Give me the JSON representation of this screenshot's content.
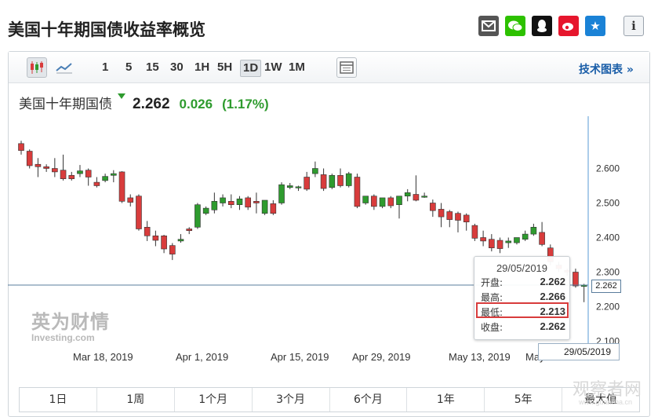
{
  "page": {
    "title": "美国十年期国债收益率概览"
  },
  "share": [
    {
      "name": "mail-icon",
      "glyph": "✉",
      "color": "#555555"
    },
    {
      "name": "wechat-icon",
      "glyph": "●",
      "color": "#2dc100"
    },
    {
      "name": "qq-icon",
      "glyph": "♟",
      "color": "#111111"
    },
    {
      "name": "weibo-icon",
      "glyph": "◉",
      "color": "#e6162d"
    },
    {
      "name": "favorite-star-icon",
      "glyph": "★",
      "color": "#1a82d6"
    }
  ],
  "info_icon": "i",
  "toolbar": {
    "intervals": [
      "1",
      "5",
      "15",
      "30",
      "1H",
      "5H",
      "1D",
      "1W",
      "1M"
    ],
    "active_interval": "1D",
    "tech_chart_link": "技术图表 »"
  },
  "instrument": {
    "name": "美国十年期国债",
    "price": "2.262",
    "change": "0.026",
    "change_pct": "(1.17%)",
    "up_color": "#2e9b2e"
  },
  "tooltip": {
    "date": "29/05/2019",
    "rows": [
      {
        "label": "开盘:",
        "value": "2.262"
      },
      {
        "label": "最高:",
        "value": "2.266"
      },
      {
        "label": "最低:",
        "value": "2.213"
      },
      {
        "label": "收盘:",
        "value": "2.262"
      }
    ],
    "highlight_color": "#d83c3c"
  },
  "crosshair": {
    "price_label": "2.262",
    "date_label": "29/05/2019"
  },
  "watermark": {
    "cn": "英为财情",
    "en": "Investing.com"
  },
  "corner_mark": {
    "cn": "观察者网",
    "url": "www.guancha.cn"
  },
  "range_tabs": [
    "1日",
    "1周",
    "1个月",
    "3个月",
    "6个月",
    "1年",
    "5年",
    "最大值"
  ],
  "chart_data": {
    "type": "candlestick",
    "x_axis": {
      "tick_labels": [
        "Mar 18, 2019",
        "Apr 1, 2019",
        "Apr 15, 2019",
        "Apr 29, 2019",
        "May 13, 2019",
        "May"
      ]
    },
    "y_axis": {
      "range": [
        2.1,
        2.7
      ],
      "ticks": [
        "2.600",
        "2.500",
        "2.400",
        "2.300",
        "2.200",
        "2.100"
      ],
      "position": "right"
    },
    "grid": false,
    "up_color": "#2e9b2e",
    "down_color": "#d83c3c",
    "candles": [
      {
        "o": 2.672,
        "h": 2.68,
        "c": 2.652,
        "l": 2.64
      },
      {
        "o": 2.65,
        "h": 2.655,
        "c": 2.608,
        "l": 2.6
      },
      {
        "o": 2.612,
        "h": 2.63,
        "c": 2.605,
        "l": 2.575
      },
      {
        "o": 2.605,
        "h": 2.612,
        "c": 2.6,
        "l": 2.59
      },
      {
        "o": 2.6,
        "h": 2.63,
        "c": 2.59,
        "l": 2.575
      },
      {
        "o": 2.595,
        "h": 2.64,
        "c": 2.57,
        "l": 2.565
      },
      {
        "o": 2.58,
        "h": 2.59,
        "c": 2.57,
        "l": 2.565
      },
      {
        "o": 2.585,
        "h": 2.61,
        "c": 2.593,
        "l": 2.575
      },
      {
        "o": 2.595,
        "h": 2.6,
        "c": 2.575,
        "l": 2.55
      },
      {
        "o": 2.56,
        "h": 2.575,
        "c": 2.55,
        "l": 2.545
      },
      {
        "o": 2.565,
        "h": 2.585,
        "c": 2.577,
        "l": 2.56
      },
      {
        "o": 2.58,
        "h": 2.595,
        "c": 2.585,
        "l": 2.56
      },
      {
        "o": 2.59,
        "h": 2.592,
        "c": 2.505,
        "l": 2.5
      },
      {
        "o": 2.515,
        "h": 2.525,
        "c": 2.502,
        "l": 2.49
      },
      {
        "o": 2.52,
        "h": 2.525,
        "c": 2.425,
        "l": 2.42
      },
      {
        "o": 2.43,
        "h": 2.448,
        "c": 2.405,
        "l": 2.39
      },
      {
        "o": 2.405,
        "h": 2.42,
        "c": 2.392,
        "l": 2.375
      },
      {
        "o": 2.405,
        "h": 2.408,
        "c": 2.367,
        "l": 2.355
      },
      {
        "o": 2.377,
        "h": 2.384,
        "c": 2.352,
        "l": 2.335
      },
      {
        "o": 2.39,
        "h": 2.41,
        "c": 2.395,
        "l": 2.385
      },
      {
        "o": 2.425,
        "h": 2.43,
        "c": 2.42,
        "l": 2.41
      },
      {
        "o": 2.43,
        "h": 2.5,
        "c": 2.495,
        "l": 2.425
      },
      {
        "o": 2.47,
        "h": 2.49,
        "c": 2.485,
        "l": 2.465
      },
      {
        "o": 2.48,
        "h": 2.53,
        "c": 2.505,
        "l": 2.47
      },
      {
        "o": 2.5,
        "h": 2.525,
        "c": 2.515,
        "l": 2.49
      },
      {
        "o": 2.505,
        "h": 2.525,
        "c": 2.495,
        "l": 2.485
      },
      {
        "o": 2.495,
        "h": 2.52,
        "c": 2.512,
        "l": 2.48
      },
      {
        "o": 2.515,
        "h": 2.52,
        "c": 2.488,
        "l": 2.48
      },
      {
        "o": 2.505,
        "h": 2.53,
        "c": 2.5,
        "l": 2.47
      },
      {
        "o": 2.47,
        "h": 2.485,
        "c": 2.508,
        "l": 2.465
      },
      {
        "o": 2.498,
        "h": 2.508,
        "c": 2.47,
        "l": 2.465
      },
      {
        "o": 2.5,
        "h": 2.56,
        "c": 2.553,
        "l": 2.495
      },
      {
        "o": 2.545,
        "h": 2.558,
        "c": 2.55,
        "l": 2.54
      },
      {
        "o": 2.545,
        "h": 2.55,
        "c": 2.547,
        "l": 2.535
      },
      {
        "o": 2.575,
        "h": 2.59,
        "c": 2.54,
        "l": 2.535
      },
      {
        "o": 2.585,
        "h": 2.62,
        "c": 2.6,
        "l": 2.575
      },
      {
        "o": 2.582,
        "h": 2.6,
        "c": 2.542,
        "l": 2.535
      },
      {
        "o": 2.545,
        "h": 2.585,
        "c": 2.58,
        "l": 2.54
      },
      {
        "o": 2.58,
        "h": 2.6,
        "c": 2.55,
        "l": 2.545
      },
      {
        "o": 2.55,
        "h": 2.59,
        "c": 2.585,
        "l": 2.545
      },
      {
        "o": 2.575,
        "h": 2.585,
        "c": 2.49,
        "l": 2.485
      },
      {
        "o": 2.5,
        "h": 2.51,
        "c": 2.52,
        "l": 2.495
      },
      {
        "o": 2.52,
        "h": 2.525,
        "c": 2.49,
        "l": 2.48
      },
      {
        "o": 2.49,
        "h": 2.5,
        "c": 2.515,
        "l": 2.485
      },
      {
        "o": 2.515,
        "h": 2.52,
        "c": 2.492,
        "l": 2.485
      },
      {
        "o": 2.495,
        "h": 2.5,
        "c": 2.52,
        "l": 2.455
      },
      {
        "o": 2.52,
        "h": 2.54,
        "c": 2.53,
        "l": 2.505
      },
      {
        "o": 2.525,
        "h": 2.58,
        "c": 2.508,
        "l": 2.505
      },
      {
        "o": 2.52,
        "h": 2.53,
        "c": 2.52,
        "l": 2.515
      },
      {
        "o": 2.5,
        "h": 2.51,
        "c": 2.478,
        "l": 2.46
      },
      {
        "o": 2.482,
        "h": 2.5,
        "c": 2.46,
        "l": 2.43
      },
      {
        "o": 2.475,
        "h": 2.48,
        "c": 2.452,
        "l": 2.43
      },
      {
        "o": 2.47,
        "h": 2.475,
        "c": 2.45,
        "l": 2.415
      },
      {
        "o": 2.465,
        "h": 2.47,
        "c": 2.445,
        "l": 2.42
      },
      {
        "o": 2.435,
        "h": 2.44,
        "c": 2.398,
        "l": 2.39
      },
      {
        "o": 2.4,
        "h": 2.42,
        "c": 2.39,
        "l": 2.375
      },
      {
        "o": 2.395,
        "h": 2.41,
        "c": 2.37,
        "l": 2.36
      },
      {
        "o": 2.392,
        "h": 2.4,
        "c": 2.368,
        "l": 2.355
      },
      {
        "o": 2.385,
        "h": 2.4,
        "c": 2.39,
        "l": 2.37
      },
      {
        "o": 2.385,
        "h": 2.395,
        "c": 2.4,
        "l": 2.38
      },
      {
        "o": 2.395,
        "h": 2.42,
        "c": 2.41,
        "l": 2.39
      },
      {
        "o": 2.41,
        "h": 2.44,
        "c": 2.43,
        "l": 2.405
      },
      {
        "o": 2.415,
        "h": 2.445,
        "c": 2.38,
        "l": 2.375
      },
      {
        "o": 2.37,
        "h": 2.38,
        "c": 2.33,
        "l": 2.32
      },
      {
        "o": 2.32,
        "h": 2.33,
        "c": 2.31,
        "l": 2.3
      },
      {
        "o": 2.305,
        "h": 2.31,
        "c": 2.3,
        "l": 2.29
      },
      {
        "o": 2.3,
        "h": 2.31,
        "c": 2.26,
        "l": 2.255
      },
      {
        "o": 2.262,
        "h": 2.266,
        "c": 2.262,
        "l": 2.213
      }
    ]
  }
}
